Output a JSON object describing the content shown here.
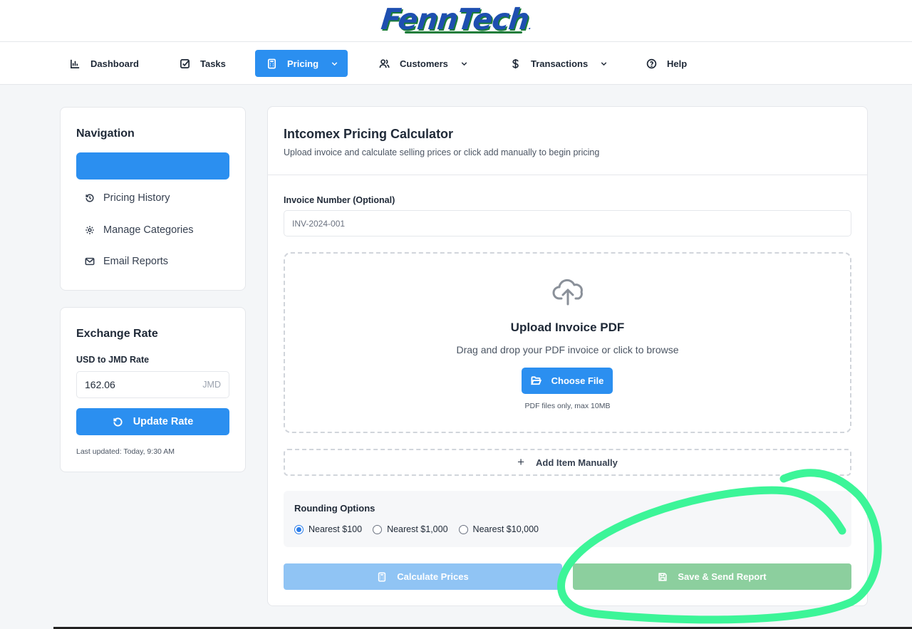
{
  "brand": {
    "logo_text": "FennTech",
    "trademark": "."
  },
  "topnav": {
    "items": [
      {
        "label": "Dashboard",
        "icon": "bar-chart-icon"
      },
      {
        "label": "Tasks",
        "icon": "check-square-icon"
      },
      {
        "label": "Pricing",
        "icon": "calculator-icon",
        "active": true,
        "has_dropdown": true
      },
      {
        "label": "Customers",
        "icon": "users-icon",
        "has_dropdown": true
      },
      {
        "label": "Transactions",
        "icon": "dollar-icon",
        "has_dropdown": true
      },
      {
        "label": "Help",
        "icon": "help-circle-icon"
      }
    ]
  },
  "sidebar": {
    "title": "Navigation",
    "items": [
      {
        "label": "",
        "active": true
      },
      {
        "label": "Pricing History",
        "icon": "history-icon"
      },
      {
        "label": "Manage Categories",
        "icon": "gear-icon"
      },
      {
        "label": "Email Reports",
        "icon": "mail-icon"
      }
    ]
  },
  "exchange": {
    "title": "Exchange Rate",
    "label": "USD to JMD Rate",
    "value": "162.06",
    "unit": "JMD",
    "button": "Update Rate",
    "last_updated": "Last updated: Today, 9:30 AM"
  },
  "main": {
    "title": "Intcomex Pricing Calculator",
    "subtitle": "Upload invoice and calculate selling prices or click add manually to begin pricing",
    "invoice_label": "Invoice Number (Optional)",
    "invoice_placeholder": "INV-2024-001",
    "upload": {
      "title": "Upload Invoice PDF",
      "hint": "Drag and drop your PDF invoice or click to browse",
      "button": "Choose File",
      "note": "PDF files only, max 10MB"
    },
    "add_manual": "Add Item Manually",
    "rounding": {
      "title": "Rounding Options",
      "options": [
        "Nearest $100",
        "Nearest $1,000",
        "Nearest $10,000"
      ],
      "selected": "Nearest $100"
    },
    "calculate_button": "Calculate Prices",
    "save_button": "Save & Send Report"
  },
  "colors": {
    "accent": "#2b8ff0",
    "calculate_disabled": "#90c4f4",
    "save_disabled": "#8ccf9e",
    "annotation_highlight": "#3cf598",
    "logo_blue": "#1e4fb0",
    "logo_green": "#1b7d3a"
  }
}
